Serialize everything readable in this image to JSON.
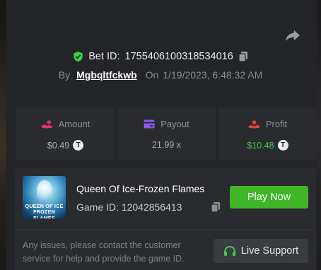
{
  "bet": {
    "id_label": "Bet ID:",
    "id_value": "1755406100318534016",
    "by_label": "By",
    "username": "Mgbqltfckwb",
    "on_label": "On",
    "timestamp": "1/19/2023, 6:48:32 AM"
  },
  "stats": [
    {
      "label": "Amount",
      "value": "$0.49",
      "icon": "hand-coin-icon",
      "value_color": "#a9adb2",
      "coin": "T"
    },
    {
      "label": "Payout",
      "value": "21.99 x",
      "icon": "card-icon",
      "value_color": "#a9adb2"
    },
    {
      "label": "Profit",
      "value": "$10.48",
      "icon": "profit-hand-icon",
      "value_color": "#3ecf4a",
      "coin": "T"
    }
  ],
  "game": {
    "name": "Queen Of Ice-Frozen Flames",
    "id_label": "Game ID: 12042856413",
    "thumb_line1": "QUEEN OF ICE",
    "thumb_line2": "FROZEN FLAMES",
    "play_label": "Play Now",
    "notice": "Any issues, please contact the customer service for help and provide the game ID.",
    "support_label": "Live Support"
  },
  "colors": {
    "accent_green": "#3fb628",
    "amount_icon": "#e0336a",
    "payout_icon": "#8a57e8",
    "profit_icon": "#e84141",
    "shield": "#3ecf4a"
  }
}
